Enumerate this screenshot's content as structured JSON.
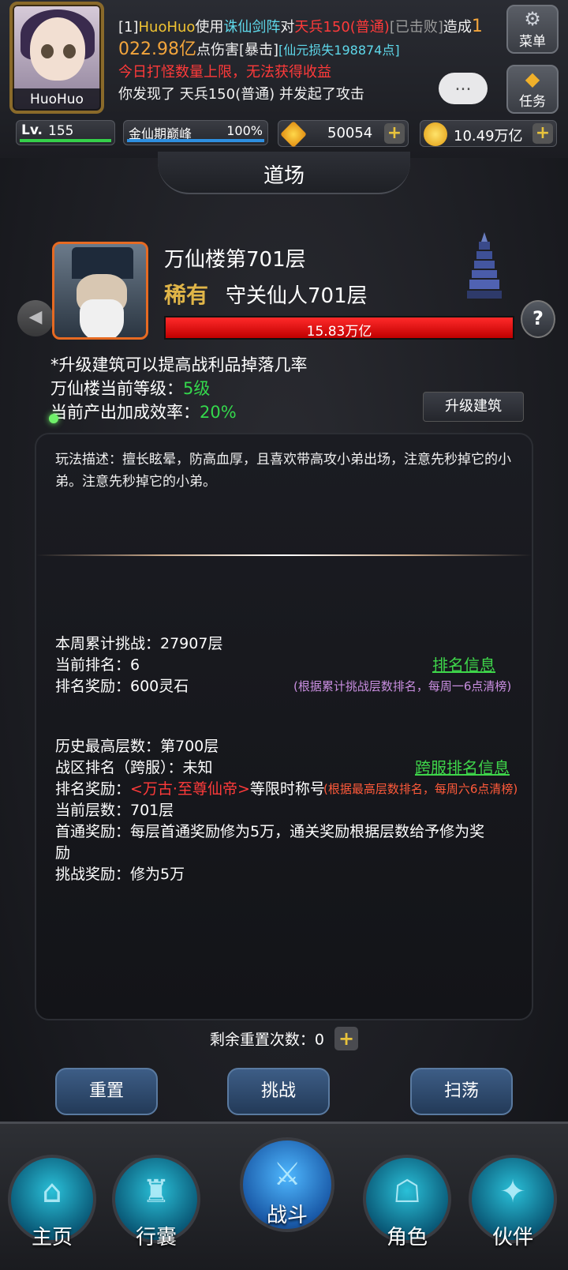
{
  "player": {
    "name": "HuoHuo",
    "level_label": "Lv.",
    "level": "155",
    "realm": "金仙期巅峰",
    "realm_progress": "100%",
    "diamonds": "50054",
    "gold": "10.49万亿"
  },
  "messages": {
    "l1_prefix": "[1]",
    "l1_name": "HuoHuo",
    "l1_t1": "使用",
    "l1_skill": "诛仙剑阵",
    "l1_t2": "对",
    "l1_target": "天兵150(普通)",
    "l1_status": "[已击败]",
    "l1_t3": "造成",
    "l1_dmg_a": "1",
    "l2_dmg_b": "022.98亿",
    "l2_t1": "点伤害[暴击]",
    "l2_loss": "[仙元损失198874点]",
    "l3": "今日打怪数量上限，无法获得收益",
    "l4": "你发现了 天兵150(普通) 并发起了攻击"
  },
  "side_buttons": {
    "menu": "菜单",
    "task": "任务"
  },
  "chat_icon": "...",
  "page_title": "道场",
  "boss": {
    "floor": "万仙楼第701层",
    "rarity": "稀有",
    "name": "守关仙人701层",
    "hp": "15.83万亿",
    "hp_fraction": 1.0,
    "help": "?"
  },
  "building": {
    "tip": "*升级建筑可以提高战利品掉落几率",
    "level_label": "万仙楼当前等级：",
    "level_value": "5级",
    "efficiency_label": "当前产出加成效率：",
    "efficiency_value": "20%",
    "upgrade_button": "升级建筑"
  },
  "panel": {
    "description": "玩法描述：擅长眩晕，防高血厚，且喜欢带高攻小弟出场，注意先秒掉它的小弟。注意先秒掉它的小弟。",
    "weekly_challenge": "本周累计挑战：27907层",
    "current_rank": "当前排名：6",
    "rank_reward": "排名奖励：600灵石",
    "rank_info_link": "排名信息",
    "rank_info_note": "(根据累计挑战层数排名，每周一6点清榜)",
    "history_best": "历史最高层数：第700层",
    "zone_rank": "战区排名（跨服）：未知",
    "cross_reward_label": "排名奖励：",
    "cross_reward_title": "<万古·至尊仙帝>",
    "cross_reward_suffix": "等限时称号",
    "cross_info_link": "跨服排名信息",
    "cross_info_note": "(根据最高层数排名，每周六6点清榜)",
    "current_floor": "当前层数：701层",
    "first_clear_line1": "首通奖励：每层首通奖励修为5万，通关奖励根据层数给予修为奖",
    "first_clear_line2": "励",
    "challenge_reward": "挑战奖励：修为5万"
  },
  "reset": {
    "label": "剩余重置次数：0",
    "plus": "+"
  },
  "actions": {
    "reset": "重置",
    "challenge": "挑战",
    "sweep": "扫荡"
  },
  "nav": [
    {
      "label": "主页",
      "icon": "home-icon"
    },
    {
      "label": "行囊",
      "icon": "bag-icon"
    },
    {
      "label": "战斗",
      "icon": "battle-icon"
    },
    {
      "label": "角色",
      "icon": "character-icon"
    },
    {
      "label": "伙伴",
      "icon": "partner-icon"
    }
  ]
}
